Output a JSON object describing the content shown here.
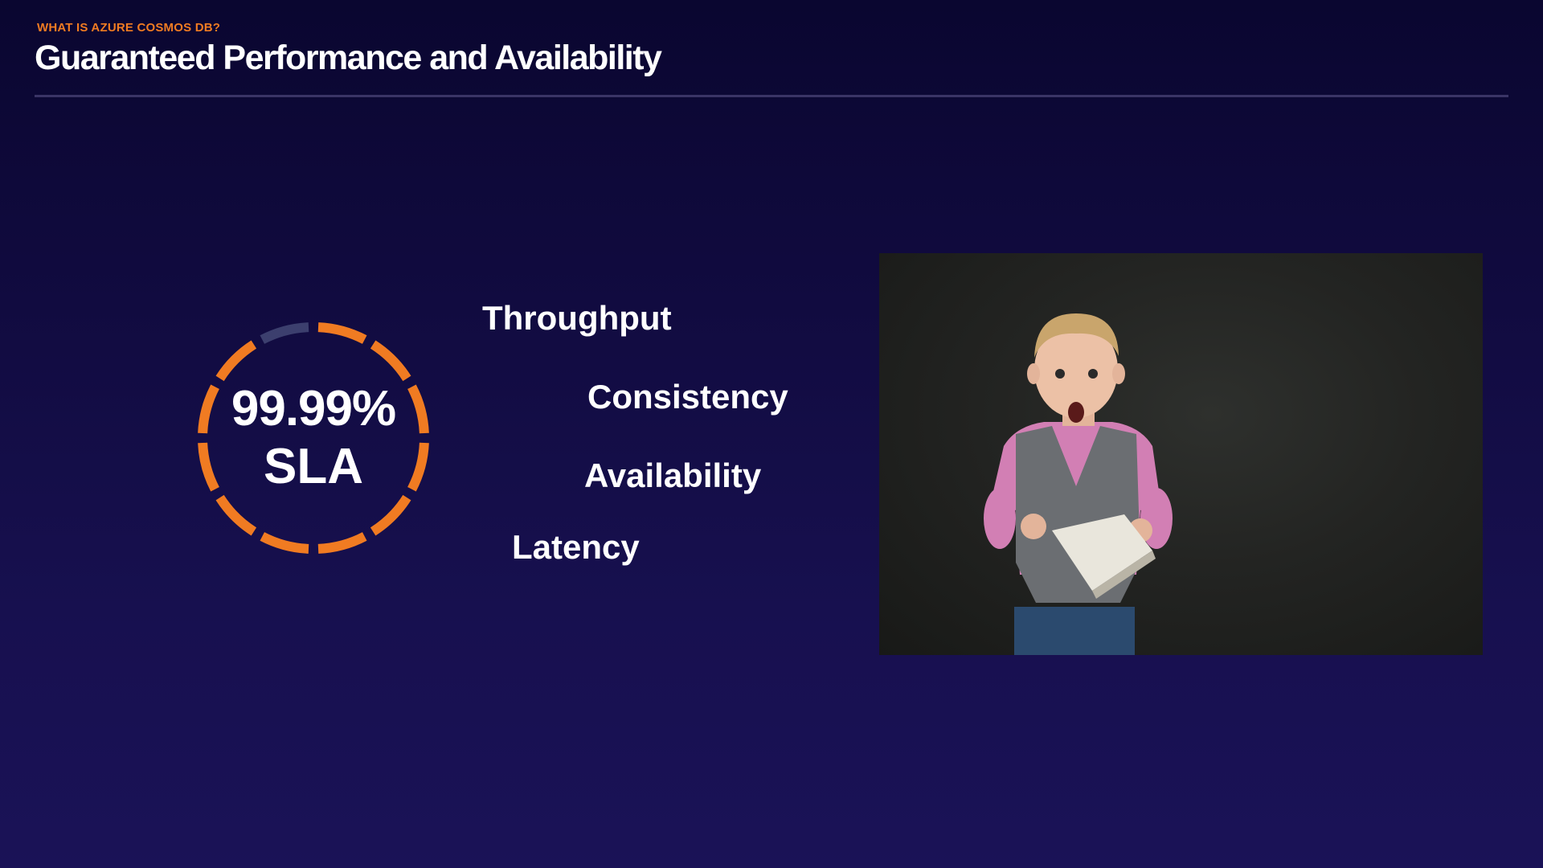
{
  "header": {
    "eyebrow": "WHAT IS AZURE COSMOS DB?",
    "title": "Guaranteed Performance and Availability"
  },
  "gauge": {
    "value": "99.99%",
    "label": "SLA",
    "segments_total": 12,
    "segments_filled": 11,
    "filled_color": "#f07b22",
    "empty_color": "#3c3f6e"
  },
  "words": [
    "Throughput",
    "Consistency",
    "Availability",
    "Latency"
  ],
  "colors": {
    "accent": "#f07b22",
    "background_top": "#0a0630",
    "background_bottom": "#1a1257"
  }
}
